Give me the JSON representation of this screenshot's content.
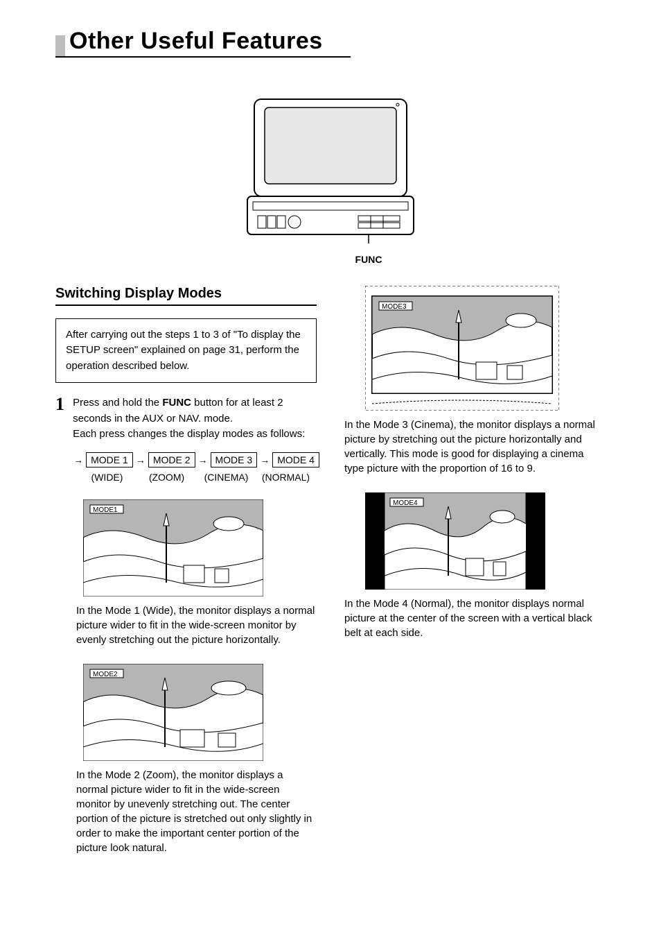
{
  "title": "Other Useful Features",
  "device_label": "FUNC",
  "section_heading": "Switching Display Modes",
  "note_box": "After carrying out the steps 1 to 3 of \"To display the SETUP screen\" explained on page 31, perform the operation described below.",
  "step1": {
    "number": "1",
    "line1_pre": "Press and hold the ",
    "line1_bold": "FUNC",
    "line1_post": " button for at least 2 seconds in the AUX or NAV. mode.",
    "line2": "Each press changes the display modes as follows:"
  },
  "modes": {
    "m1": "MODE 1",
    "m2": "MODE 2",
    "m3": "MODE 3",
    "m4": "MODE 4",
    "s1": "(WIDE)",
    "s2": "(ZOOM)",
    "s3": "(CINEMA)",
    "s4": "(NORMAL)"
  },
  "mode1": {
    "label": "MODE1",
    "desc": "In the Mode 1 (Wide), the monitor displays a normal picture wider to fit in the wide-screen monitor by evenly stretching out the picture horizontally."
  },
  "mode2": {
    "label": "MODE2",
    "desc": "In the Mode 2 (Zoom), the monitor displays a normal picture wider to fit in the wide-screen monitor by unevenly stretching out. The center portion of the picture is stretched out only slightly in order to make the important center portion of the picture look natural."
  },
  "mode3": {
    "label": "MODE3",
    "desc": "In the Mode 3 (Cinema), the monitor displays a normal picture by stretching out the picture horizontally and vertically. This mode is good for displaying a cinema type picture with the proportion of 16 to 9."
  },
  "mode4": {
    "label": "MODE4",
    "desc": "In the Mode 4 (Normal), the monitor displays normal picture at the center of the screen with a vertical black belt at each side."
  }
}
